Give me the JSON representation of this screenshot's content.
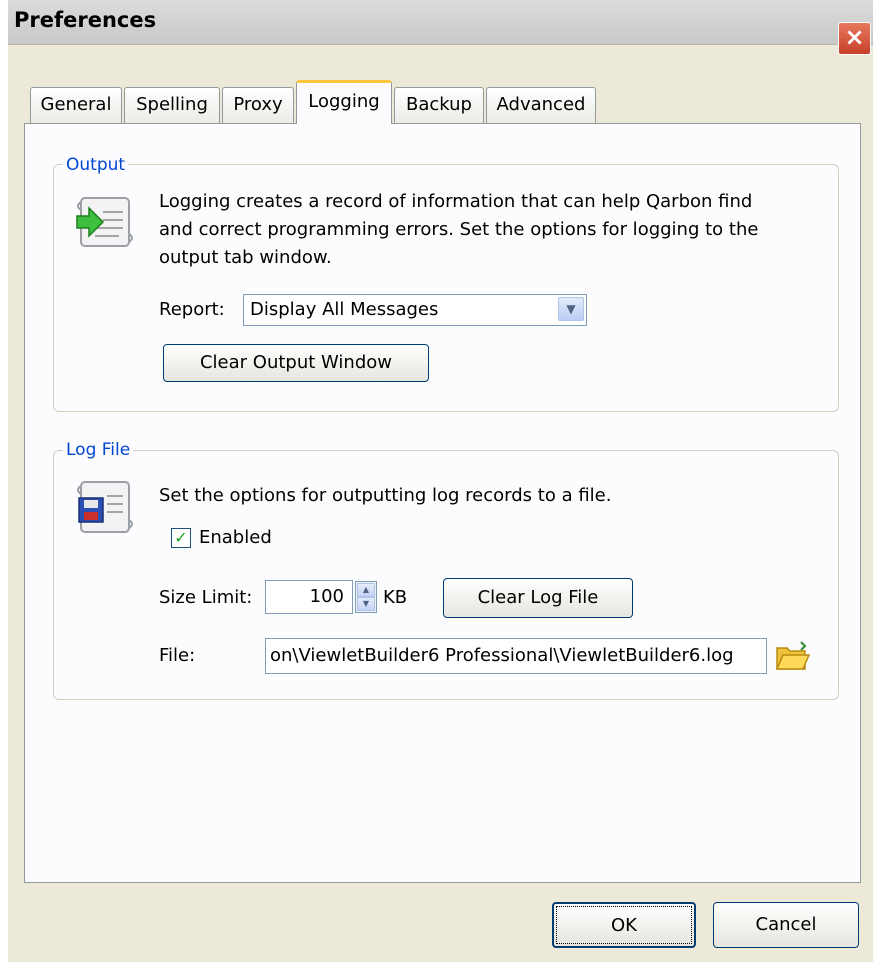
{
  "window": {
    "title": "Preferences",
    "close_label": "×"
  },
  "tabs": [
    {
      "label": "General"
    },
    {
      "label": "Spelling"
    },
    {
      "label": "Proxy"
    },
    {
      "label": "Logging"
    },
    {
      "label": "Backup"
    },
    {
      "label": "Advanced"
    }
  ],
  "active_tab": "Logging",
  "output_group": {
    "title": "Output",
    "description_lines": [
      "Logging creates a record of information that can help Qarbon find",
      "and correct programming errors. Set the options for logging to the",
      "output tab window."
    ],
    "report_label": "Report:",
    "report_value": "Display All Messages",
    "clear_button": "Clear Output Window",
    "icon": "scroll-arrow-icon"
  },
  "logfile_group": {
    "title": "Log File",
    "description": "Set the options for outputting log records to a file.",
    "enabled_label": "Enabled",
    "enabled_checked": true,
    "checkmark": "✓",
    "size_limit_label": "Size Limit:",
    "size_limit_value": "100",
    "size_unit": "KB",
    "spin_up": "▲",
    "spin_down": "▼",
    "clear_button": "Clear Log File",
    "file_label": "File:",
    "file_value": "on\\ViewletBuilder6 Professional\\ViewletBuilder6.log",
    "icon": "scroll-disk-icon",
    "browse_icon": "folder-icon"
  },
  "dialog_buttons": {
    "ok": "OK",
    "cancel": "Cancel"
  },
  "colors": {
    "group_title": "#0046d5",
    "active_tab_accent": "#ffc83c"
  }
}
